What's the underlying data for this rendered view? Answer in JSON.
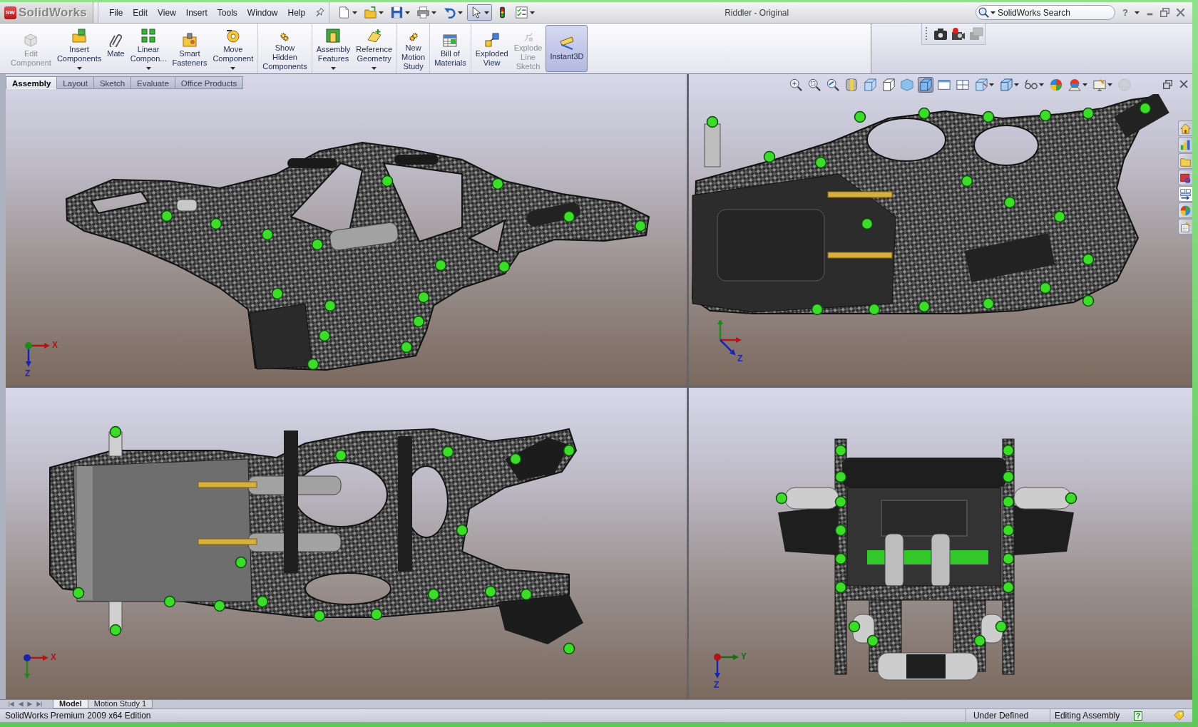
{
  "title_bar": {
    "logo_mark": "SW",
    "logo": "SolidWorks",
    "menu": [
      {
        "label": "File"
      },
      {
        "label": "Edit"
      },
      {
        "label": "View"
      },
      {
        "label": "Insert"
      },
      {
        "label": "Tools"
      },
      {
        "label": "Window"
      },
      {
        "label": "Help"
      }
    ],
    "quick_tools": [
      {
        "selected": false
      },
      {
        "selected": false
      },
      {
        "selected": false
      },
      {
        "selected": false
      },
      {
        "selected": false
      },
      {
        "selected": true
      },
      {
        "selected": false
      },
      {
        "selected": false
      }
    ],
    "title": "Riddler - Original",
    "search": {
      "placeholder": "SolidWorks Search"
    },
    "help": "?"
  },
  "command_manager": {
    "groups": [
      {
        "buttons": [
          {
            "label": "Edit\nComponent",
            "disabled": true,
            "dropdown": false,
            "on": false
          },
          {
            "label": "Insert\nComponents",
            "disabled": false,
            "dropdown": true,
            "on": false
          },
          {
            "label": "Mate",
            "disabled": false,
            "dropdown": false,
            "on": false
          },
          {
            "label": "Linear\nCompon...",
            "disabled": false,
            "dropdown": true,
            "on": false
          },
          {
            "label": "Smart\nFasteners",
            "disabled": false,
            "dropdown": false,
            "on": false
          },
          {
            "label": "Move\nComponent",
            "disabled": false,
            "dropdown": true,
            "on": false
          }
        ]
      },
      {
        "buttons": [
          {
            "label": "Show\nHidden\nComponents",
            "disabled": false,
            "dropdown": false,
            "on": false
          }
        ]
      },
      {
        "buttons": [
          {
            "label": "Assembly\nFeatures",
            "disabled": false,
            "dropdown": true,
            "on": false
          },
          {
            "label": "Reference\nGeometry",
            "disabled": false,
            "dropdown": true,
            "on": false
          }
        ]
      },
      {
        "buttons": [
          {
            "label": "New\nMotion\nStudy",
            "disabled": false,
            "dropdown": false,
            "on": false
          }
        ]
      },
      {
        "buttons": [
          {
            "label": "Bill of\nMaterials",
            "disabled": false,
            "dropdown": false,
            "on": false
          }
        ]
      },
      {
        "buttons": [
          {
            "label": "Exploded\nView",
            "disabled": false,
            "dropdown": false,
            "on": false
          },
          {
            "label": "Explode\nLine\nSketch",
            "disabled": true,
            "dropdown": false,
            "on": false
          },
          {
            "label": "Instant3D",
            "disabled": false,
            "dropdown": false,
            "on": true
          }
        ]
      }
    ]
  },
  "camera_tools": [
    {
      "disabled": false
    },
    {
      "disabled": false
    },
    {
      "disabled": true
    }
  ],
  "tabs": [
    {
      "label": "Assembly",
      "selected": true
    },
    {
      "label": "Layout",
      "selected": false
    },
    {
      "label": "Sketch",
      "selected": false
    },
    {
      "label": "Evaluate",
      "selected": false
    },
    {
      "label": "Office Products",
      "selected": false
    }
  ],
  "view_toolbar": [
    {
      "selected": false,
      "disabled": false
    },
    {
      "selected": false,
      "disabled": false
    },
    {
      "selected": false,
      "disabled": false
    },
    {
      "selected": false,
      "disabled": false
    },
    {
      "selected": false,
      "disabled": false
    },
    {
      "selected": false,
      "disabled": false
    },
    {
      "selected": false,
      "disabled": false
    },
    {
      "selected": true,
      "disabled": false
    },
    {
      "selected": false,
      "disabled": false
    },
    {
      "selected": false,
      "disabled": false
    },
    {
      "selected": false,
      "disabled": false
    },
    {
      "selected": false,
      "disabled": false
    },
    {
      "selected": false,
      "disabled": false
    },
    {
      "selected": false,
      "disabled": false
    },
    {
      "selected": false,
      "disabled": false
    },
    {
      "selected": false,
      "disabled": false
    },
    {
      "selected": false,
      "disabled": true
    }
  ],
  "task_pane": [
    {
      "selected": false
    },
    {
      "selected": false
    },
    {
      "selected": false
    },
    {
      "selected": false
    },
    {
      "selected": true
    },
    {
      "selected": false
    },
    {
      "selected": false
    }
  ],
  "viewports": [
    {
      "axes": [
        {
          "label": "X",
          "color": "#b01414"
        },
        {
          "label": "Z",
          "color": "#1a22b4"
        },
        {
          "color": "#1e8a1e"
        }
      ]
    },
    {
      "axes": [
        {
          "color": "#1e8a1e"
        },
        {
          "color": "#b01414"
        },
        {
          "label": "Z",
          "color": "#1a22b4"
        }
      ]
    },
    {
      "axes": [
        {
          "label": "X",
          "color": "#b01414"
        },
        {
          "color": "#1e8a1e"
        },
        {
          "color": "#1a22b4"
        }
      ]
    },
    {
      "axes": [
        {
          "label": "Y",
          "color": "#146e14"
        },
        {
          "label": "Z",
          "color": "#1a22b4"
        },
        {
          "color": "#b01414"
        }
      ]
    }
  ],
  "bottom_tabs": [
    {
      "label": "Model",
      "selected": true
    },
    {
      "label": "Motion Study 1",
      "selected": false
    }
  ],
  "status_bar": {
    "edition": "SolidWorks Premium 2009 x64 Edition",
    "state": "Under Defined",
    "mode": "Editing Assembly",
    "help": "?"
  }
}
